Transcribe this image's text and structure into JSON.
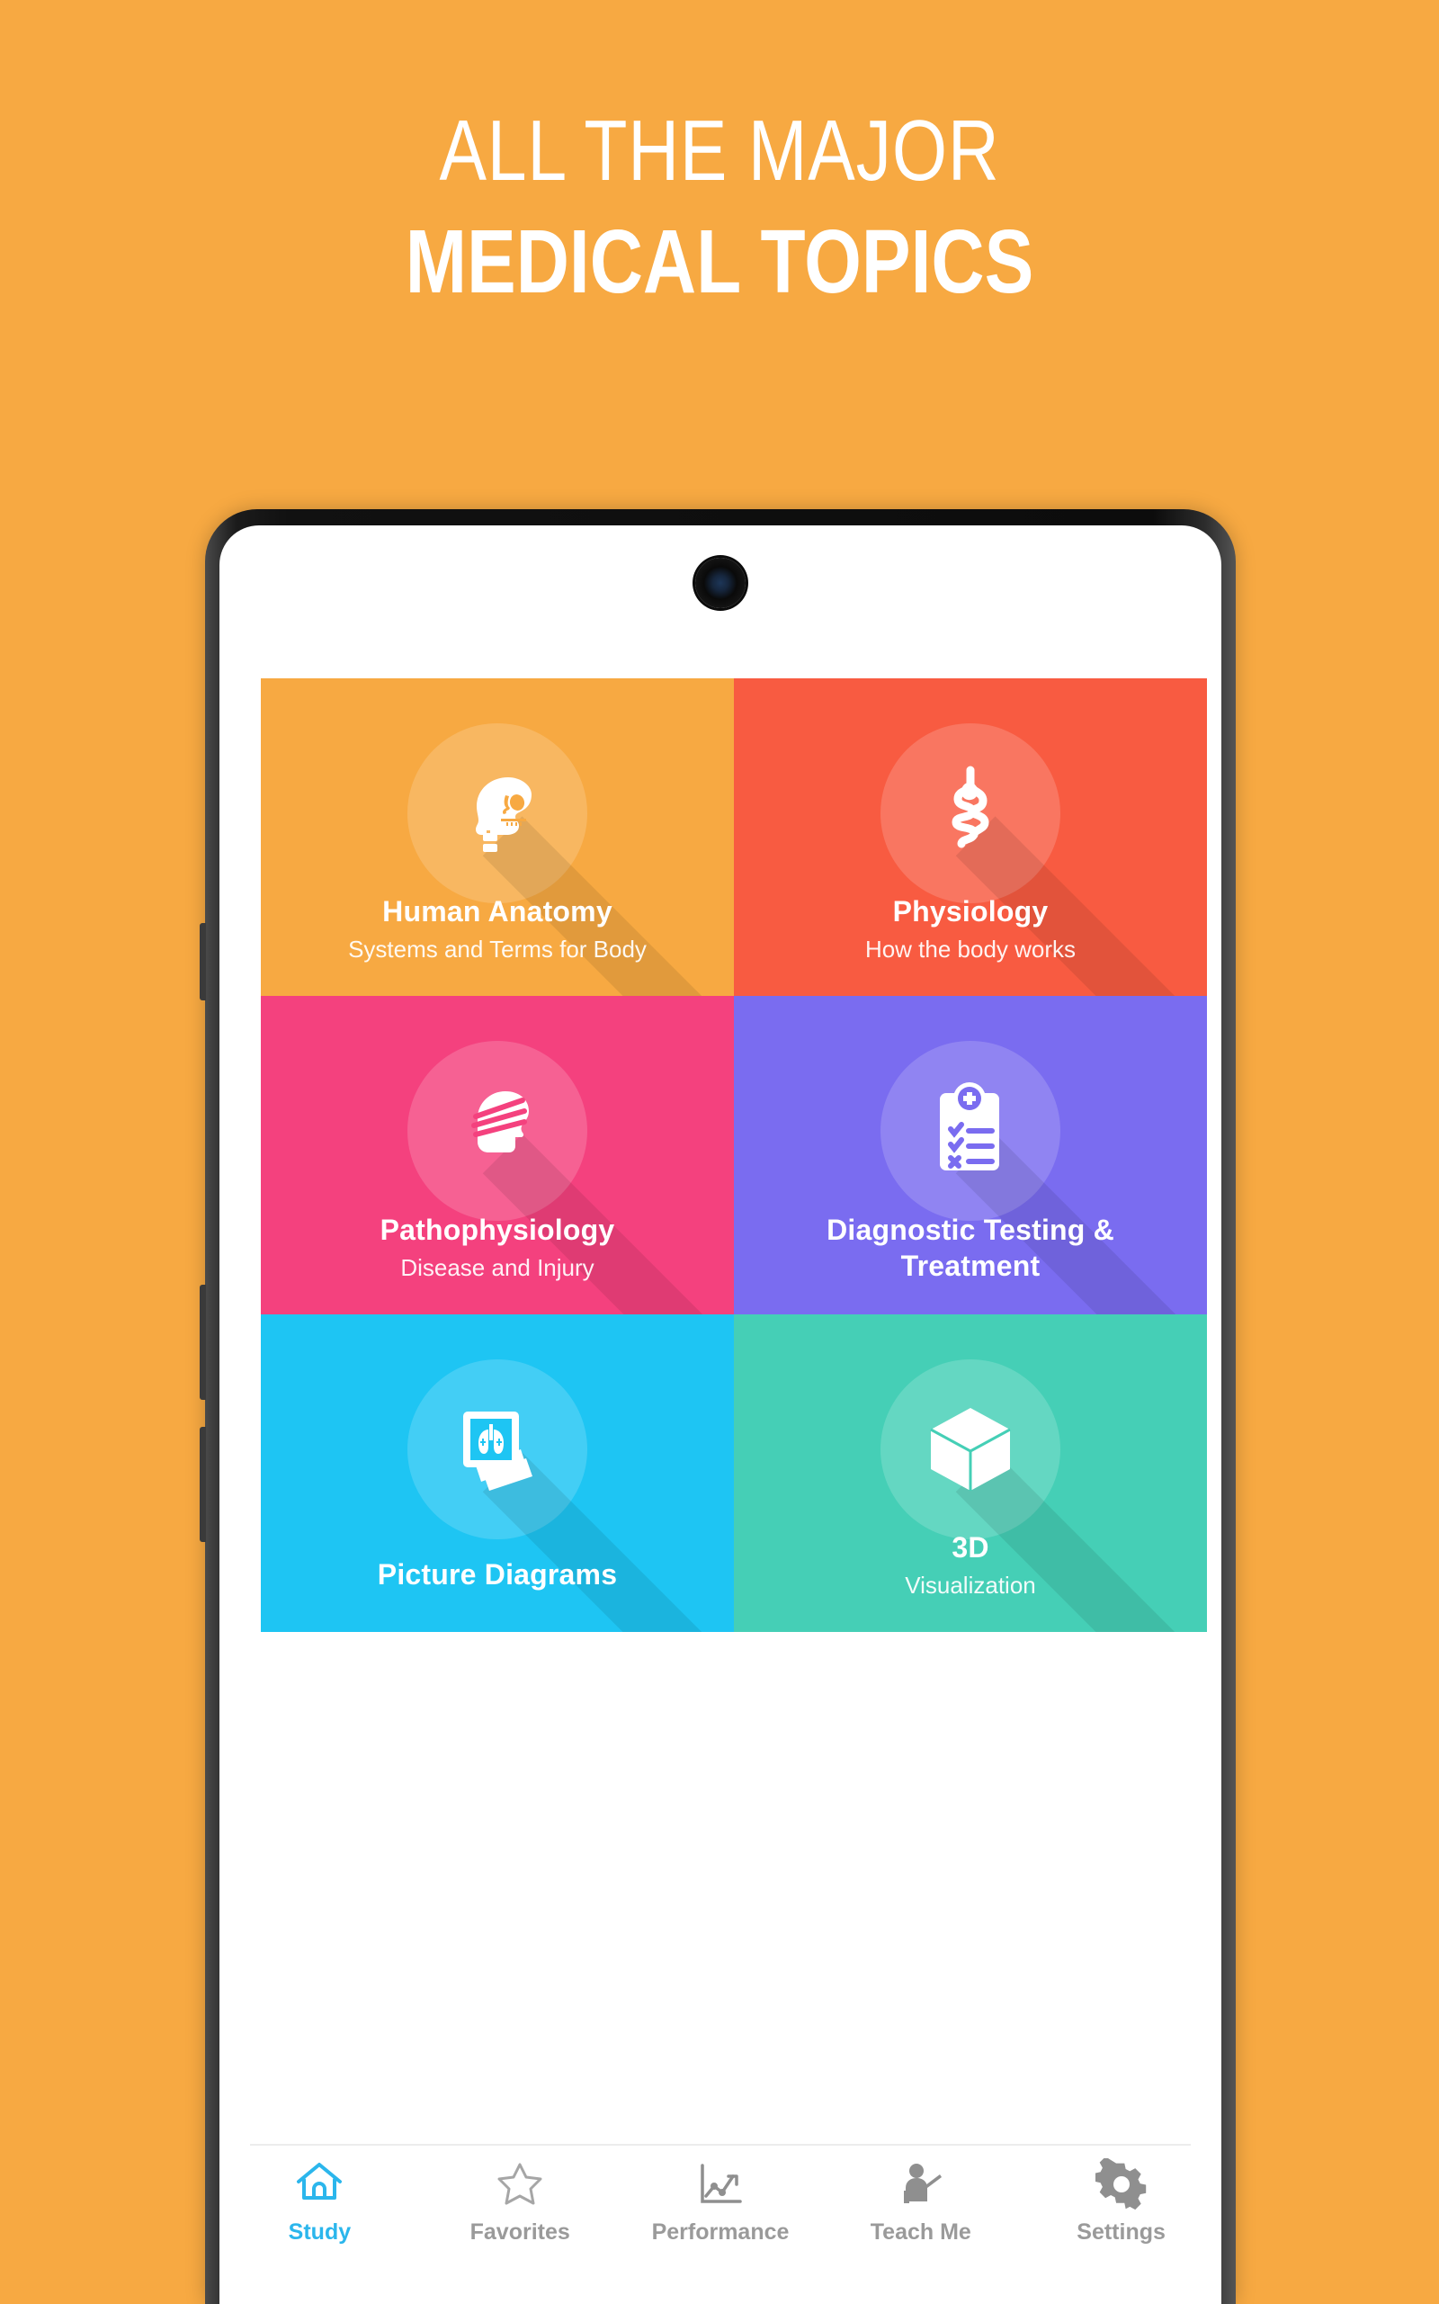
{
  "promo": {
    "line1": "ALL THE MAJOR",
    "line2": "MEDICAL TOPICS",
    "background_color": "#F7A942",
    "text_color": "#FFFFFF"
  },
  "device": {
    "camera_icon": "front-camera-icon"
  },
  "app": {
    "grid": {
      "tiles": [
        {
          "id": "human-anatomy",
          "label": "Human Anatomy",
          "sub": "Systems and Terms for Body",
          "color": "#F7A942",
          "icon": "skull-icon"
        },
        {
          "id": "physiology",
          "label": "Physiology",
          "sub": "How the body works",
          "color": "#F85B41",
          "icon": "intestine-icon"
        },
        {
          "id": "pathophysiology",
          "label": "Pathophysiology",
          "sub": "Disease and Injury",
          "color": "#F4417E",
          "icon": "bandaged-head-icon"
        },
        {
          "id": "diagnostic-testing-treatment",
          "label": "Diagnostic Testing &",
          "sub": "Treatment",
          "color": "#7A6CF0",
          "icon": "medical-clipboard-icon"
        },
        {
          "id": "picture-diagrams",
          "label": "Picture Diagrams",
          "sub": "",
          "color": "#1EC5F3",
          "icon": "xray-photos-icon"
        },
        {
          "id": "three-d",
          "label": "3D",
          "sub": "Visualization",
          "color": "#45CFB6",
          "icon": "cube-icon"
        }
      ]
    },
    "bottom_nav": {
      "active_color": "#2BB6EC",
      "inactive_color": "#9A9A9A",
      "items": [
        {
          "id": "study",
          "label": "Study",
          "icon": "home-icon",
          "active": true
        },
        {
          "id": "favorites",
          "label": "Favorites",
          "icon": "star-icon",
          "active": false
        },
        {
          "id": "performance",
          "label": "Performance",
          "icon": "line-chart-icon",
          "active": false
        },
        {
          "id": "teach-me",
          "label": "Teach Me",
          "icon": "teacher-icon",
          "active": false
        },
        {
          "id": "settings",
          "label": "Settings",
          "icon": "gear-icon",
          "active": false
        }
      ]
    }
  }
}
